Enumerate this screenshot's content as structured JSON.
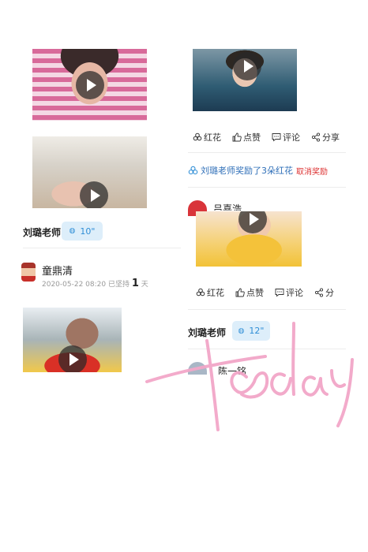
{
  "left_column": {
    "voice_row": {
      "label": "刘璐老师:",
      "duration": "10\""
    },
    "post": {
      "author": "童鼎清",
      "meta_time": "2020-05-22 08:20",
      "meta_prefix": "已坚持",
      "meta_days": "1",
      "meta_suffix": "天"
    }
  },
  "right_column": {
    "actions_top": {
      "flower": "红花",
      "like": "点赞",
      "comment": "评论",
      "share": "分享"
    },
    "reward": {
      "text": "刘璐老师奖励了3朵红花",
      "cancel": "取消奖励"
    },
    "partial_name_top": "吕喜浩",
    "actions_bottom": {
      "flower": "红花",
      "like": "点赞",
      "comment": "评论",
      "share": "分"
    },
    "voice_row": {
      "label": "刘璐老师",
      "duration": "12\""
    },
    "partial_name_bottom": "陈一铭"
  },
  "overlay": {
    "handwriting": "Today",
    "color": "#f2a6c8"
  },
  "colors": {
    "accent_blue": "#2f8ed6",
    "badge_bg": "#ddeefa",
    "reward_red": "#d33333"
  }
}
